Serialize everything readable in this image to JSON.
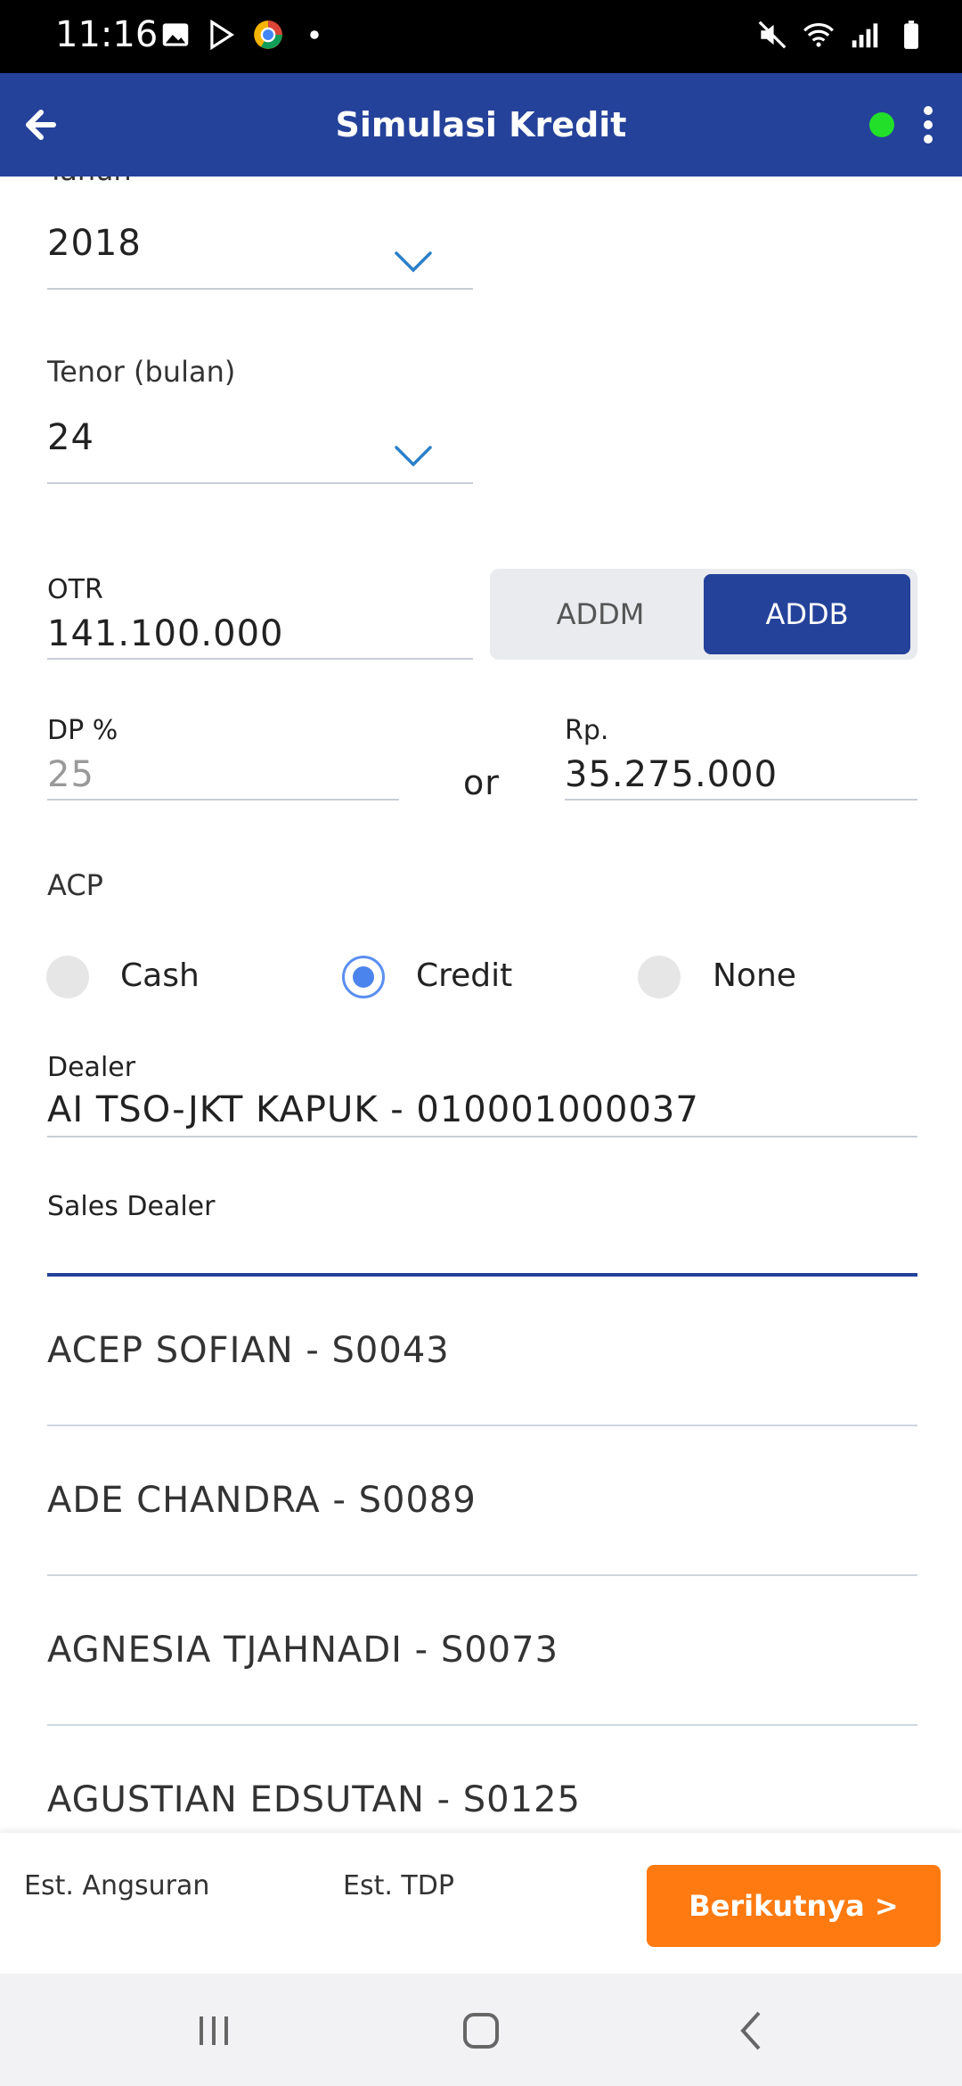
{
  "status_bar": {
    "time": "11:16",
    "left_icons": [
      "gallery-icon",
      "play-store-icon",
      "chrome-like-icon",
      "dot-icon"
    ],
    "right_icons": [
      "mute-icon",
      "wifi-icon",
      "signal-icon",
      "battery-icon"
    ]
  },
  "app_bar": {
    "title": "Simulasi Kredit",
    "back_icon": "back-arrow-icon",
    "status_color": "#22e02a",
    "menu_icon": "overflow-menu-icon"
  },
  "form": {
    "tahun": {
      "label": "Tahun",
      "value": "2018"
    },
    "tenor": {
      "label": "Tenor (bulan)",
      "value": "24"
    },
    "otr": {
      "label": "OTR",
      "value": "141.100.000"
    },
    "toggle": {
      "options": [
        "ADDM",
        "ADDB"
      ],
      "selected": "ADDB"
    },
    "dp_percent": {
      "label": "DP %",
      "value": "25"
    },
    "or_text": "or",
    "dp_rp": {
      "label": "Rp.",
      "value": "35.275.000"
    },
    "acp": {
      "label": "ACP",
      "options": [
        "Cash",
        "Credit",
        "None"
      ],
      "selected": "Credit"
    },
    "dealer": {
      "label": "Dealer",
      "value": "AI TSO-JKT KAPUK - 010001000037"
    },
    "sales_dealer": {
      "label": "Sales Dealer",
      "value": ""
    }
  },
  "dropdown_list": [
    "ACEP SOFIAN - S0043",
    "ADE CHANDRA - S0089",
    "AGNESIA TJAHNADI - S0073",
    "AGUSTIAN EDSUTAN - S0125"
  ],
  "bottom_bar": {
    "est_angsuran_label": "Est. Angsuran",
    "est_tdp_label": "Est. TDP",
    "next_button": "Berikutnya >"
  },
  "colors": {
    "primary": "#25429a",
    "accent": "#ff7a10",
    "radio_selected": "#4c84ee"
  }
}
